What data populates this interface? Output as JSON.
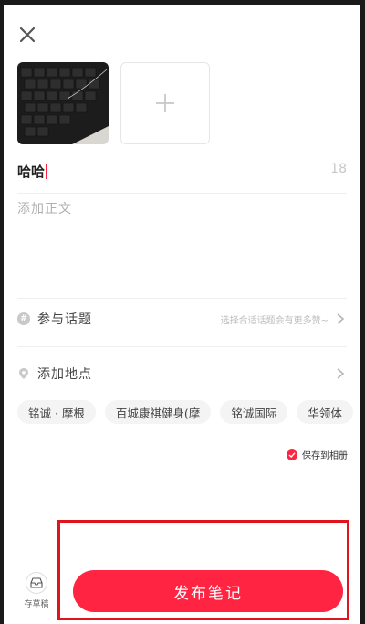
{
  "editor": {
    "title_value": "哈哈",
    "char_count": "18",
    "body_placeholder": "添加正文"
  },
  "topic": {
    "label": "参与话题",
    "hint": "选择合适话题会有更多赞~",
    "icon": "hash-icon"
  },
  "location": {
    "label": "添加地点",
    "icon": "location-pin-icon",
    "suggestions": [
      "铭诚 · 摩根",
      "百城康祺健身(摩",
      "铭诚国际",
      "华领体"
    ]
  },
  "save_to_album": {
    "label": "保存到相册",
    "checked": true
  },
  "footer": {
    "draft_label": "存草稿",
    "publish_label": "发布笔记"
  },
  "colors": {
    "accent": "#ff2442",
    "highlight_box": "#e0141e"
  }
}
